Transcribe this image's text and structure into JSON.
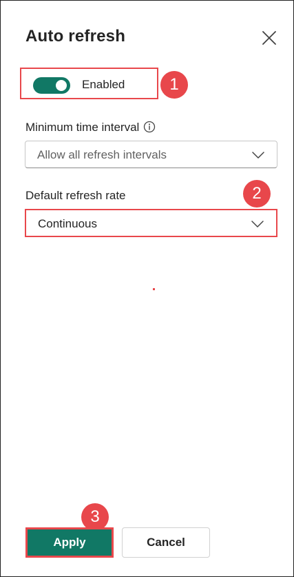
{
  "dialog": {
    "title": "Auto refresh",
    "close_icon": "close-icon"
  },
  "toggle": {
    "label": "Enabled",
    "state": "on",
    "color": "#117865"
  },
  "min_interval": {
    "label": "Minimum time interval",
    "info_icon": "info-icon",
    "value": "Allow all refresh intervals"
  },
  "default_rate": {
    "label": "Default refresh rate",
    "value": "Continuous"
  },
  "annotations": {
    "badge_1": "1",
    "badge_2": "2",
    "badge_3": "3",
    "color": "#e8474b"
  },
  "buttons": {
    "apply": "Apply",
    "cancel": "Cancel"
  }
}
